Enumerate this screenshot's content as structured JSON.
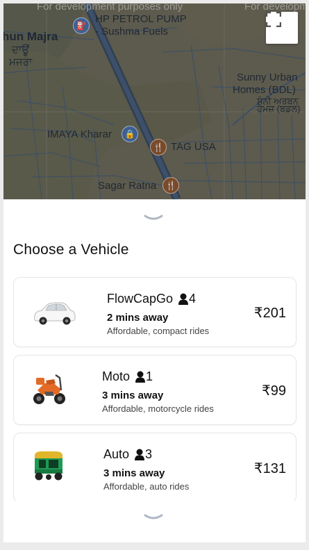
{
  "map": {
    "watermark_left": "For development purposes only",
    "watermark_right": "For developm",
    "places": {
      "majra_en": "hun Majra",
      "majra_pa_1": "ਦਾਊਂ",
      "majra_pa_2": "ਮਜਰਾ",
      "petrol_1": "HP PETROL PUMP",
      "petrol_2": "- Sushma Fuels",
      "sunny_1": "Sunny Urban",
      "sunny_2": "Homes (BDL)",
      "sunny_pa_1": "ਸੰਨੀ ਅਰਬਨ",
      "sunny_pa_2": "ਹੋਮਜ਼ (ਬਡਲ)",
      "imaya": "IMAYA Kharar",
      "tag": "TAG USA",
      "sagar": "Sagar Ratna"
    },
    "fullscreen_icon": "fullscreen-icon"
  },
  "panel": {
    "title": "Choose a Vehicle",
    "vehicles": [
      {
        "name": "FlowCapGo",
        "capacity": "4",
        "eta": "2 mins away",
        "desc": "Affordable, compact rides",
        "price": "₹201",
        "icon": "car-icon"
      },
      {
        "name": "Moto",
        "capacity": "1",
        "eta": "3 mins away",
        "desc": "Affordable, motorcycle rides",
        "price": "₹99",
        "icon": "motorcycle-icon"
      },
      {
        "name": "Auto",
        "capacity": "3",
        "eta": "3 mins away",
        "desc": "Affordable, auto rides",
        "price": "₹131",
        "icon": "auto-rickshaw-icon"
      }
    ]
  },
  "colors": {
    "map_overlay": "#5d5b4e",
    "map_green": "#4f6b4d",
    "map_road": "#3a4e63",
    "pin_blue": "#3e5f93",
    "pin_brown": "#7a4a2a"
  }
}
